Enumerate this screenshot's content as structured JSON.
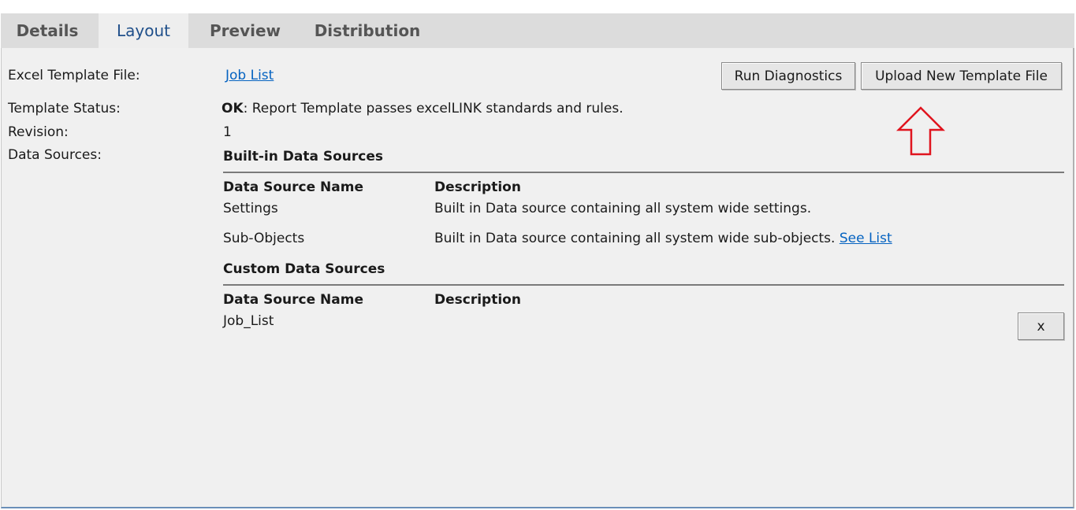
{
  "tabs": [
    {
      "label": "Details",
      "active": false
    },
    {
      "label": "Layout",
      "active": true
    },
    {
      "label": "Preview",
      "active": false
    },
    {
      "label": "Distribution",
      "active": false
    }
  ],
  "fields": {
    "template_file_label": "Excel Template File:",
    "template_file_value": "Job List",
    "status_label": "Template Status:",
    "status_ok": "OK",
    "status_message": ": Report Template passes excelLINK standards and rules.",
    "revision_label": "Revision:",
    "revision_value": "1",
    "data_sources_label": "Data Sources:"
  },
  "buttons": {
    "run_diagnostics": "Run Diagnostics",
    "upload_template": "Upload New Template File",
    "remove": "x"
  },
  "builtin": {
    "heading": "Built-in Data Sources",
    "col_name": "Data Source Name",
    "col_desc": "Description",
    "rows": [
      {
        "name": "Settings",
        "description": "Built in Data source containing all system wide settings.",
        "link": ""
      },
      {
        "name": "Sub-Objects",
        "description": "Built in Data source containing all system wide sub-objects.",
        "link": "See List"
      }
    ]
  },
  "custom": {
    "heading": "Custom Data Sources",
    "col_name": "Data Source Name",
    "col_desc": "Description",
    "rows": [
      {
        "name": "Job_List",
        "description": ""
      }
    ]
  },
  "colors": {
    "link": "#0563c1",
    "annotation_arrow": "#e0141e",
    "active_tab_text": "#1f4f8a"
  },
  "icons": {
    "annotation": "up-arrow-outline-icon"
  }
}
